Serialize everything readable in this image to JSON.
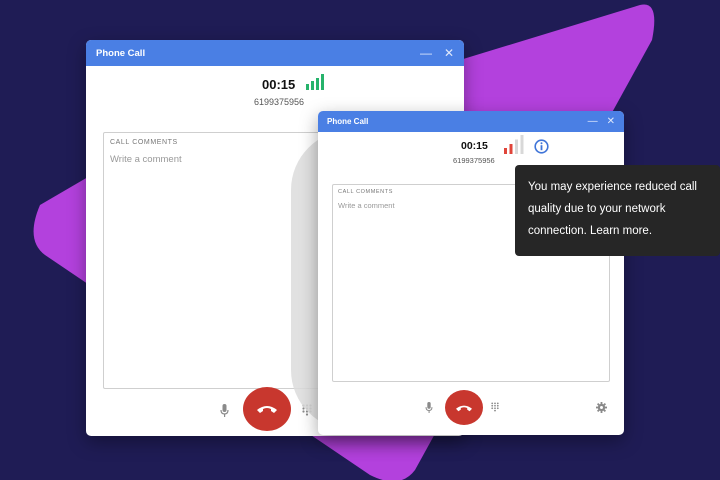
{
  "colors": {
    "background": "#1f1c55",
    "accent_shape": "#b341dd",
    "titlebar": "#4a7fe4",
    "hangup": "#c8372e",
    "signal_good": "#26b36b",
    "signal_weak": "#e0453a",
    "tooltip_bg": "#262626"
  },
  "back_window": {
    "title": "Phone Call",
    "minimize_icon": "minimize-icon",
    "close_icon": "close-icon",
    "timer": "00:15",
    "phone_number": "6199375956",
    "signal": {
      "icon": "signal-strength-icon",
      "bars_active": 4,
      "bars_total": 4,
      "color": "#26b36b"
    },
    "comments": {
      "label": "CALL COMMENTS",
      "placeholder": "Write a comment"
    },
    "controls": [
      "microphone-icon",
      "hangup-phone-icon",
      "dialpad-icon"
    ]
  },
  "front_window": {
    "title": "Phone Call",
    "minimize_icon": "minimize-icon",
    "close_icon": "close-icon",
    "timer": "00:15",
    "phone_number": "6199375956",
    "signal": {
      "icon": "signal-strength-icon",
      "bars_active": 2,
      "bars_total": 4,
      "color": "#e0453a"
    },
    "info_icon": "info-icon",
    "comments": {
      "label": "CALL COMMENTS",
      "placeholder": "Write a comment"
    },
    "controls": [
      "microphone-icon",
      "hangup-phone-icon",
      "dialpad-icon",
      "settings-gear-icon"
    ]
  },
  "tooltip": {
    "lines": [
      "You may experience reduced call",
      "quality due to your network",
      "connection. Learn more."
    ]
  }
}
